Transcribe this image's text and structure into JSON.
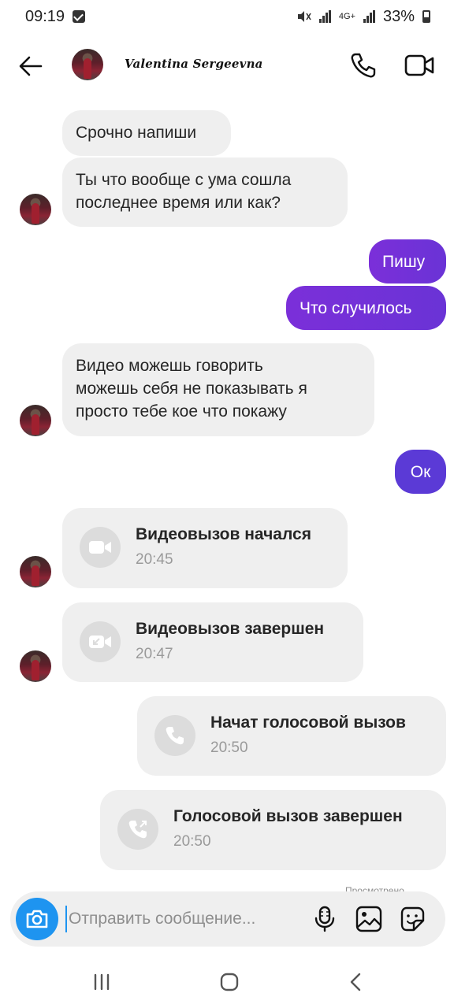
{
  "status_bar": {
    "time": "09:19",
    "network": "4G+",
    "battery": "33%"
  },
  "header": {
    "contact_name": "Valentina Sergeevna",
    "icons": [
      "back-arrow-icon",
      "phone-icon",
      "video-camera-icon"
    ]
  },
  "messages": [
    {
      "direction": "in",
      "text": "Срочно напиши"
    },
    {
      "direction": "in",
      "lines": [
        "Ты что вообще  с ума сошла",
        "последнее время или как?"
      ]
    },
    {
      "direction": "out",
      "text": "Пишу"
    },
    {
      "direction": "out",
      "text": "Что случилось"
    },
    {
      "direction": "in",
      "lines": [
        "Видео можешь говорить",
        "можешь  себя не показывать я",
        "просто тебе кое что покажу"
      ]
    },
    {
      "direction": "out",
      "text": "Ок"
    }
  ],
  "calls": [
    {
      "direction": "in",
      "title": "Видеовызов начался",
      "time": "20:45",
      "icon": "video-call-icon"
    },
    {
      "direction": "in",
      "title": "Видеовызов завершен",
      "time": "20:47",
      "icon": "video-call-ended-icon"
    },
    {
      "direction": "out",
      "title": "Начат голосовой вызов",
      "time": "20:50",
      "icon": "phone-call-icon"
    },
    {
      "direction": "out",
      "title": "Голосовой вызов завершен",
      "time": "20:50",
      "icon": "phone-call-ended-icon"
    }
  ],
  "seen_label": "Просмотрено",
  "composer": {
    "placeholder": "Отправить сообщение..."
  },
  "colors": {
    "outgoing_bubble": "#7b2fd9",
    "incoming_bubble": "#efefef",
    "camera_button": "#1e94f0"
  }
}
